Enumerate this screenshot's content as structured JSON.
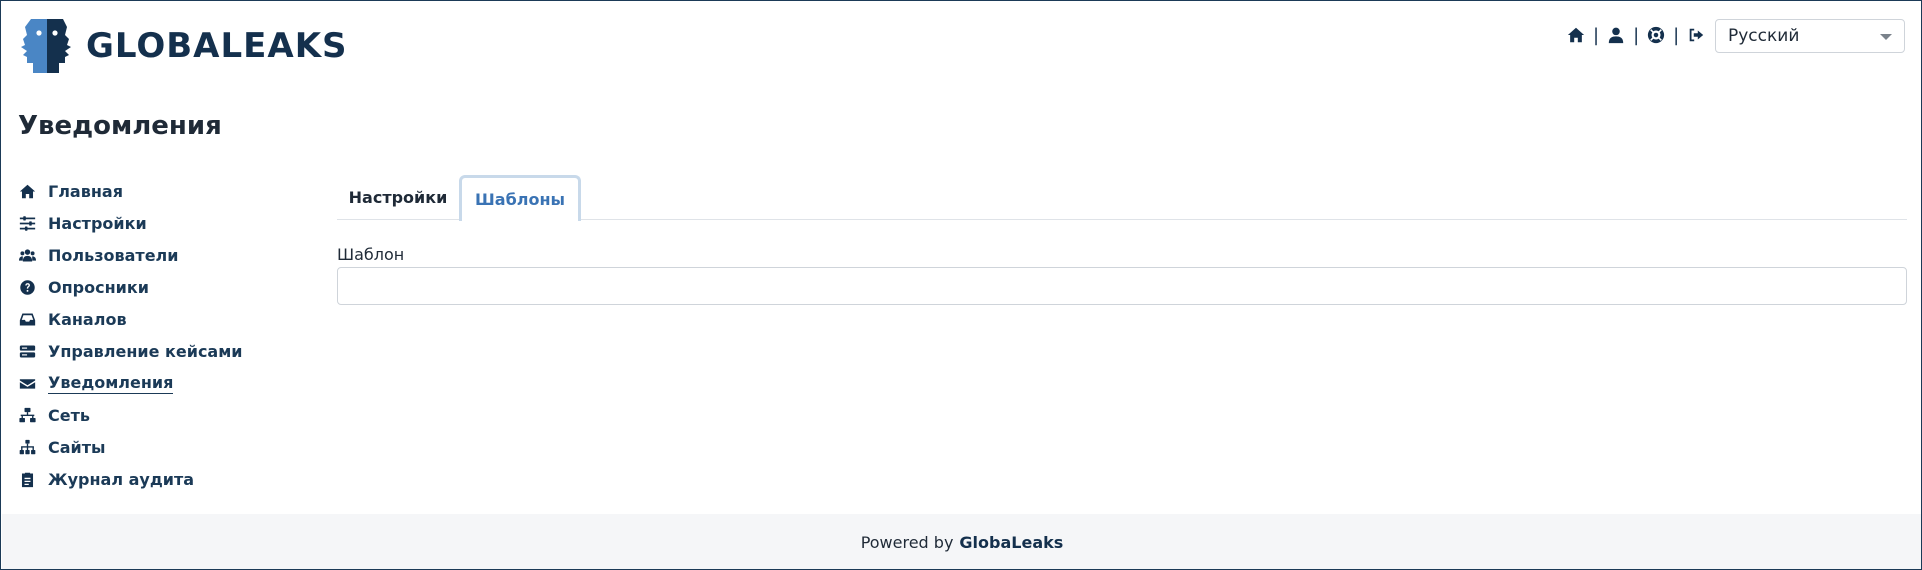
{
  "header": {
    "logo_text": "GLOBALEAKS",
    "nav_icons": [
      "home-icon",
      "user-icon",
      "support-icon",
      "logout-icon"
    ],
    "separator": "|",
    "language": {
      "selected": "Русский"
    }
  },
  "page": {
    "title": "Уведомления"
  },
  "sidebar": {
    "items": [
      {
        "label": "Главная",
        "icon": "home-icon"
      },
      {
        "label": "Настройки",
        "icon": "sliders-icon"
      },
      {
        "label": "Пользователи",
        "icon": "users-icon"
      },
      {
        "label": "Опросники",
        "icon": "question-circle-icon"
      },
      {
        "label": "Каналов",
        "icon": "inbox-icon"
      },
      {
        "label": "Управление кейсами",
        "icon": "server-icon"
      },
      {
        "label": "Уведомления",
        "icon": "envelope-icon",
        "active": true
      },
      {
        "label": "Сеть",
        "icon": "network-icon"
      },
      {
        "label": "Сайты",
        "icon": "sitemap-icon"
      },
      {
        "label": "Журнал аудита",
        "icon": "clipboard-icon"
      }
    ]
  },
  "tabs": [
    {
      "label": "Настройки",
      "active": false
    },
    {
      "label": "Шаблоны",
      "active": true
    }
  ],
  "form": {
    "template_label": "Шаблон",
    "template_value": ""
  },
  "footer": {
    "prefix": "Powered by",
    "brand": "GlobaLeaks"
  },
  "colors": {
    "brand_navy": "#14304d",
    "active_tab_text": "#3a73b4",
    "footer_bg": "#f5f6f8"
  }
}
